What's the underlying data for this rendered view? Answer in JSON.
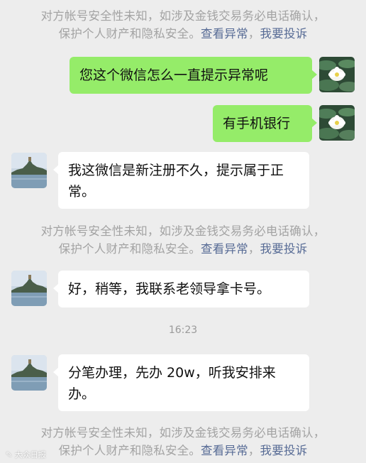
{
  "notice": {
    "line1": "对方帐号安全性未知，如涉及金钱交易务必电话确认，",
    "line2_prefix": "保护个人财产和隐私安全。",
    "view_abnormal": "查看异常",
    "separator": "，",
    "report": "我要投诉"
  },
  "messages": [
    {
      "sender": "me",
      "text": "您这个微信怎么一直提示异常呢"
    },
    {
      "sender": "me",
      "text": "有手机银行"
    },
    {
      "sender": "them",
      "text": "我这微信是新注册不久，提示属于正常。"
    },
    {
      "sender": "them",
      "text": "好，稍等，我联系老领导拿卡号。"
    },
    {
      "sender": "them",
      "text": "分笔办理，先办 20w，听我安排来办。"
    }
  ],
  "timestamp": "16:23",
  "watermark": "大众日报",
  "colors": {
    "background": "#ededed",
    "my_bubble": "#95ec69",
    "their_bubble": "#ffffff",
    "link": "#576b95",
    "notice_text": "#a3a3a3"
  },
  "icons": {
    "my_avatar": "lotus-flower-avatar",
    "their_avatar": "lake-pagoda-avatar",
    "watermark": "dazhong-logo-icon"
  }
}
